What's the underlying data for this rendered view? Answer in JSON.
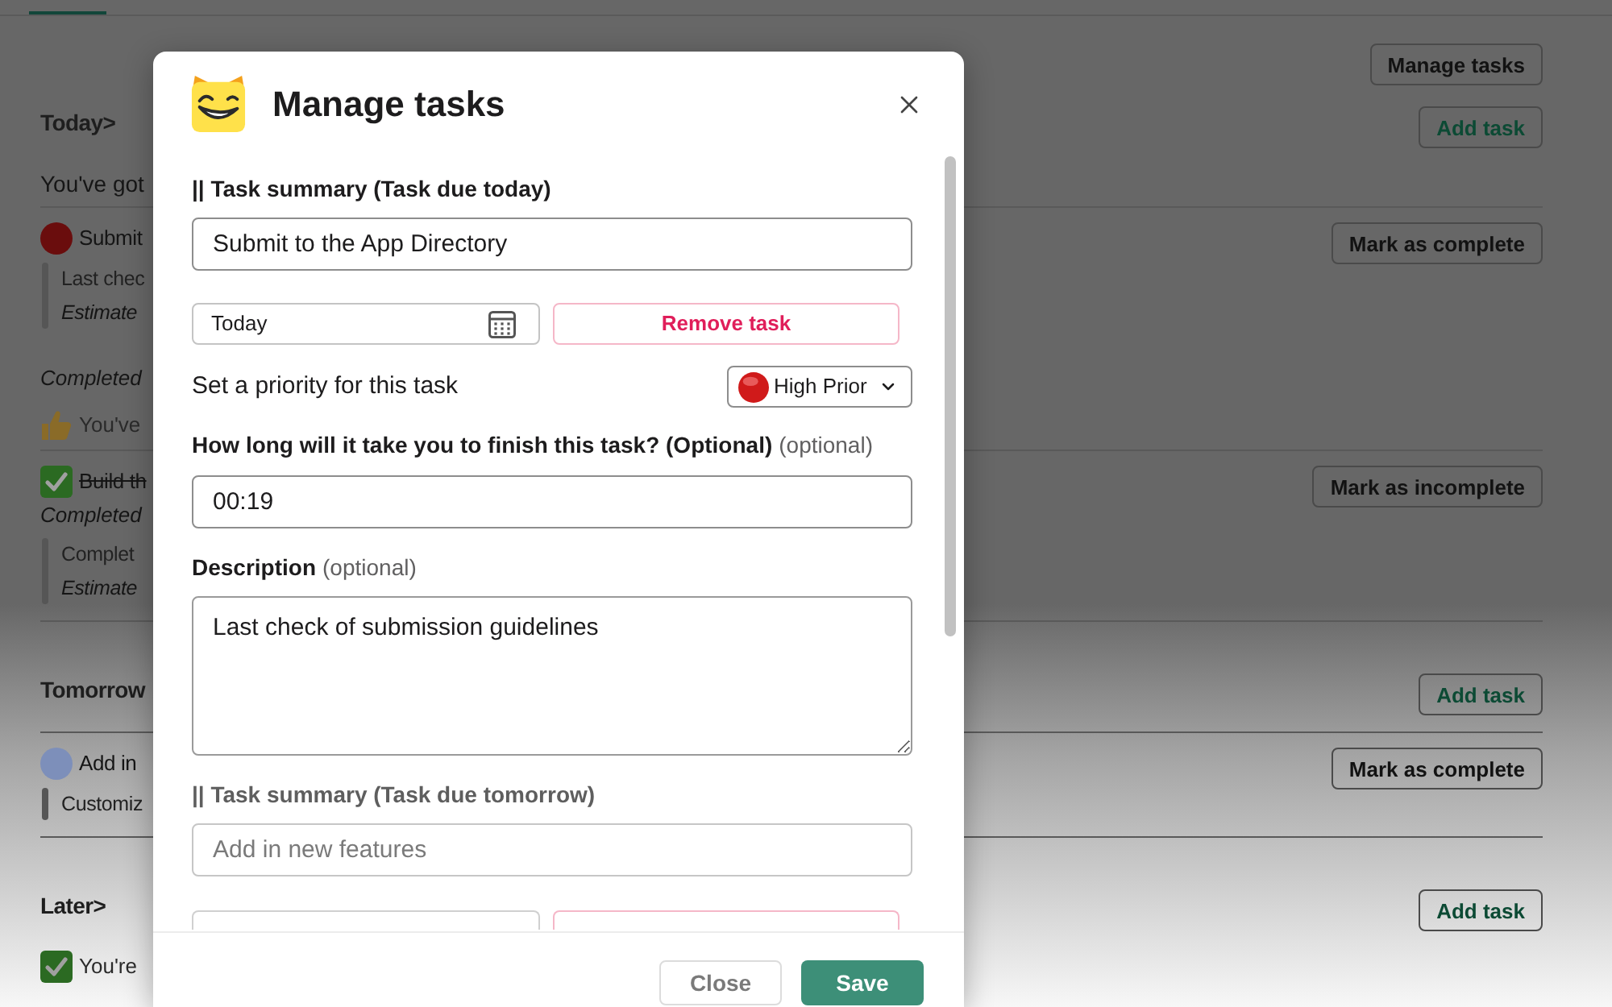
{
  "page": {
    "blocks": [
      {
        "kind": "actions",
        "button": "Manage tasks"
      },
      {
        "kind": "heading",
        "text": "Today>",
        "button": "Add task"
      },
      {
        "kind": "text",
        "text": "You've got"
      },
      {
        "kind": "divider"
      },
      {
        "kind": "task",
        "done": false,
        "color": "#6a0d0d",
        "title": "Submit",
        "description": "Last chec",
        "estimate": "Estimate",
        "button": "Mark as complete"
      },
      {
        "kind": "note",
        "text": "Completed"
      },
      {
        "kind": "praise",
        "text": "You've"
      },
      {
        "kind": "divider"
      },
      {
        "kind": "task",
        "done": true,
        "title": "Build th",
        "note": "Completed",
        "description": "Complet",
        "estimate": "Estimate",
        "button": "Mark as incomplete"
      },
      {
        "kind": "divider"
      },
      {
        "kind": "heading",
        "text": "Tomorrow",
        "button": "Add task"
      },
      {
        "kind": "divider"
      },
      {
        "kind": "task",
        "done": false,
        "color": "#7d8fba",
        "title": "Add in",
        "description": "Customiz",
        "button": "Mark as complete"
      },
      {
        "kind": "divider"
      },
      {
        "kind": "heading",
        "text": "Later>",
        "button": "Add task"
      },
      {
        "kind": "done_note",
        "text": "You're"
      }
    ]
  },
  "modal": {
    "title": "Manage tasks",
    "tasks": [
      {
        "kind": "full",
        "summary_label": "|| Task summary (Task due today)",
        "summary": {
          "value": "Submit to the App Directory"
        },
        "date": "Today",
        "remove_button": "Remove task",
        "priority_label": "Set a priority for this task",
        "priority": "High Prior",
        "duration_label": "How long will it take you to finish this task? (Optional)",
        "duration_hint": "(optional)",
        "duration": "00:19",
        "description_label": "Description",
        "description_hint": "(optional)",
        "description": "Last check of submission guidelines"
      },
      {
        "kind": "cut",
        "summary_label": "|| Task summary (Task due tomorrow)",
        "summary": {
          "placeholder": "Add in new features"
        }
      }
    ],
    "buttons": [
      {
        "kind": "secondary",
        "label": "Close"
      },
      {
        "kind": "primary",
        "label": "Save"
      }
    ]
  }
}
